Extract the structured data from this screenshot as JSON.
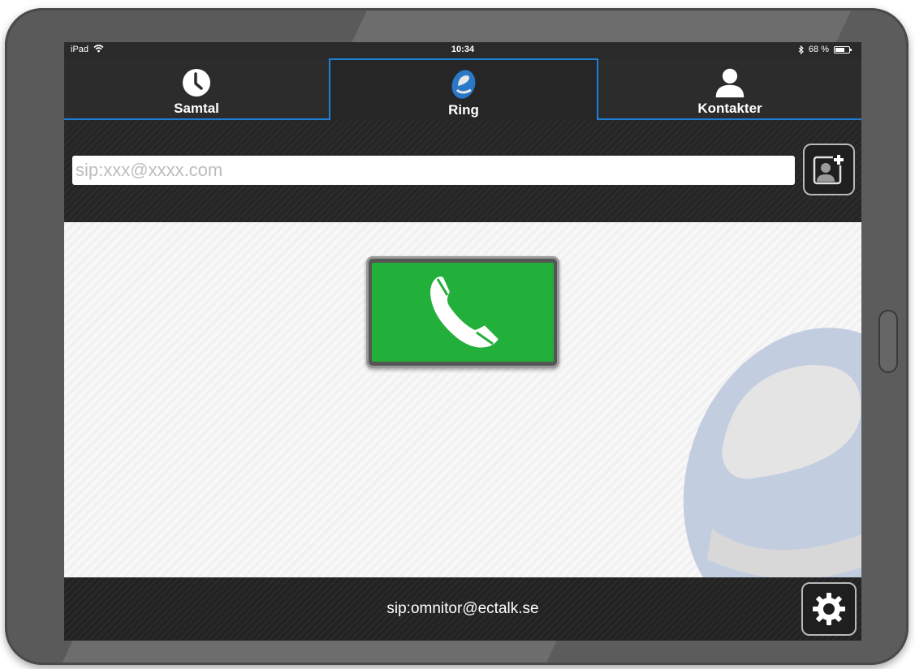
{
  "status_bar": {
    "device": "iPad",
    "time": "10:34",
    "battery_text": "68 %",
    "battery_level": 0.68
  },
  "tabs": [
    {
      "label": "Samtal",
      "icon": "clock-icon",
      "active": false
    },
    {
      "label": "Ring",
      "icon": "e-logo-icon",
      "active": true
    },
    {
      "label": "Kontakter",
      "icon": "person-icon",
      "active": false
    }
  ],
  "dial": {
    "placeholder": "sip:xxx@xxxx.com",
    "value": ""
  },
  "footer": {
    "account": "sip:omnitor@ectalk.se"
  },
  "colors": {
    "accent": "#1f7fd6",
    "call_green": "#22b03a",
    "watermark": "#c3cde0"
  }
}
